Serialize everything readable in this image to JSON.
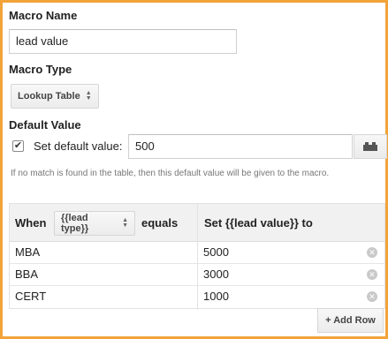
{
  "macro_name": {
    "label": "Macro Name",
    "value": "lead value"
  },
  "macro_type": {
    "label": "Macro Type",
    "selected": "Lookup Table"
  },
  "default_value": {
    "label": "Default Value",
    "checkbox_label": "Set default value:",
    "checked": true,
    "value": "500",
    "help_text": "If no match is found in the table, then this default value will be given to the macro."
  },
  "lookup_table": {
    "when_label": "When",
    "input_macro": "{{lead type}}",
    "equals_label": "equals",
    "set_label": "Set {{lead value}} to",
    "rows": [
      {
        "when": "MBA",
        "set": "5000"
      },
      {
        "when": "BBA",
        "set": "3000"
      },
      {
        "when": "CERT",
        "set": "1000"
      }
    ],
    "add_row_label": "+ Add Row"
  },
  "colors": {
    "frame_border": "#f2a33a"
  }
}
